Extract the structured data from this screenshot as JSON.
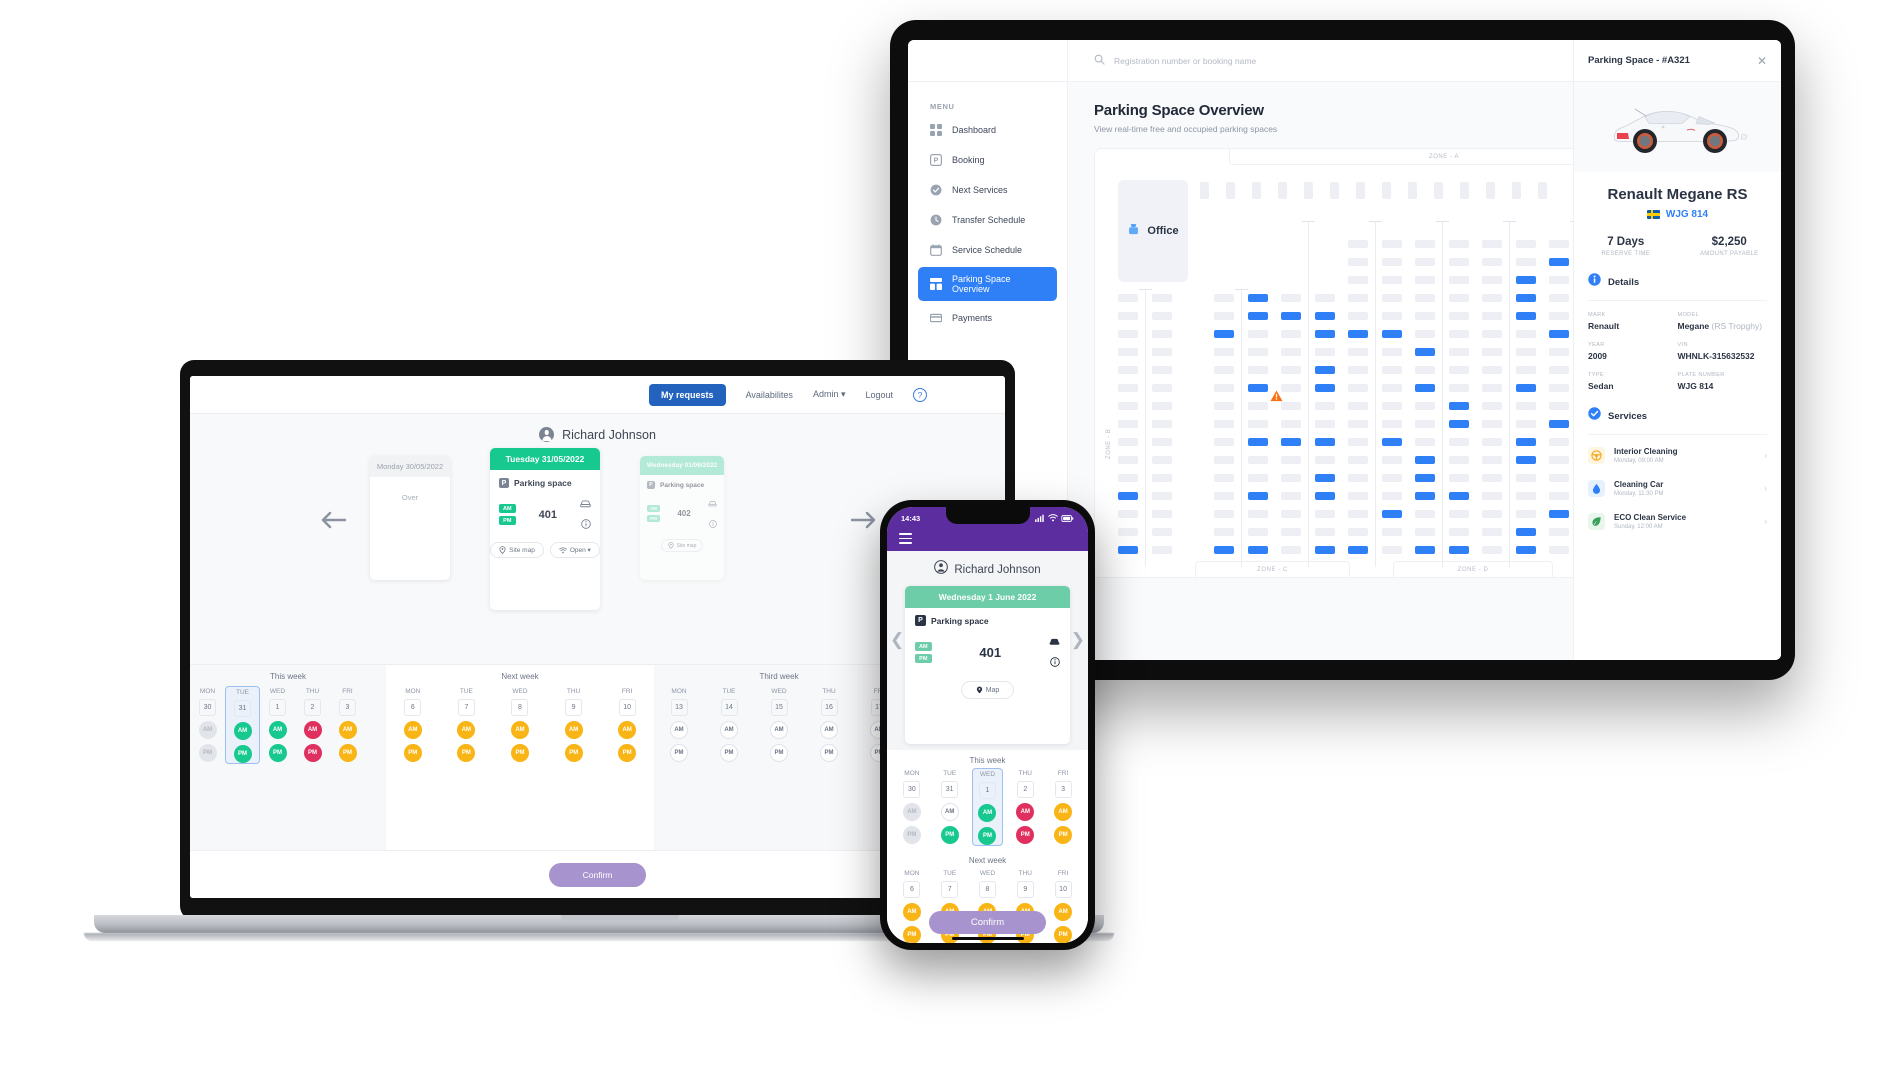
{
  "colors": {
    "accent_blue": "#2f80f7",
    "nav_active": "#2463bd",
    "green": "#17c98f",
    "green_light": "#7bdcbc",
    "red": "#e0305f",
    "amber": "#f9b515",
    "purple": "#a793cd",
    "phone_bar": "#5b2d9e"
  },
  "desktop": {
    "search": {
      "placeholder": "Registration number or booking name",
      "icon": "search-icon"
    },
    "sidebar": {
      "section_label": "MENU",
      "items": [
        {
          "label": "Dashboard",
          "icon": "grid-icon",
          "active": false
        },
        {
          "label": "Booking",
          "icon": "parking-p-icon",
          "active": false
        },
        {
          "label": "Next Services",
          "icon": "check-circle-icon",
          "active": false
        },
        {
          "label": "Transfer Schedule",
          "icon": "clock-icon",
          "active": false
        },
        {
          "label": "Service Schedule",
          "icon": "calendar-icon",
          "active": false
        },
        {
          "label": "Parking Space Overview",
          "icon": "layout-icon",
          "active": true
        },
        {
          "label": "Payments",
          "icon": "credit-card-icon",
          "active": false
        }
      ]
    },
    "page": {
      "title": "Parking Space Overview",
      "subtitle": "View real-time free and occupied parking spaces",
      "office_label": "Office",
      "zones": [
        "ZONE - A",
        "ZONE - B",
        "ZONE - C",
        "ZONE - D"
      ]
    },
    "detail": {
      "header_title": "Parking Space - #A321",
      "close_label": "✕",
      "car_name": "Renault Megane RS",
      "plate": "WJG 814",
      "stats": [
        {
          "value": "7 Days",
          "label": "RESERVE TIME"
        },
        {
          "value": "$2,250",
          "label": "AMOUNT PAYABLE"
        }
      ],
      "details_section": "Details",
      "fields": [
        {
          "key": "MARK",
          "value": "Renault",
          "note": ""
        },
        {
          "key": "MODEL",
          "value": "Megane",
          "note": "(RS Tropghy)"
        },
        {
          "key": "YEAR",
          "value": "2009",
          "note": ""
        },
        {
          "key": "VIN",
          "value": "WHNLK-315632532",
          "note": ""
        },
        {
          "key": "TYPE",
          "value": "Sedan",
          "note": ""
        },
        {
          "key": "PLATE NUMBER",
          "value": "WJG 814",
          "note": ""
        }
      ],
      "services_section": "Services",
      "services": [
        {
          "name": "Interior Cleaning",
          "when": "Monday, 09:00 AM",
          "icon": "steering-wheel-icon",
          "bg": "#fff6e0",
          "fg": "#f5ad2b"
        },
        {
          "name": "Cleaning Car",
          "when": "Monday, 11:30 PM",
          "icon": "water-drop-icon",
          "bg": "#e6f1fe",
          "fg": "#2f80f7"
        },
        {
          "name": "ECO Clean Service",
          "when": "Sunday, 12:00 AM",
          "icon": "leaf-icon",
          "bg": "#e8f6ec",
          "fg": "#39a05a"
        }
      ]
    }
  },
  "laptop": {
    "nav": [
      {
        "label": "My requests",
        "active": true
      },
      {
        "label": "Availabilites",
        "active": false
      },
      {
        "label": "Admin ▾",
        "active": false
      },
      {
        "label": "Logout",
        "active": false
      }
    ],
    "help_icon": "?",
    "user_name": "Richard Johnson",
    "cards": [
      {
        "date_label": "Monday 30/05/2022",
        "state": "over",
        "over_text": "Over"
      },
      {
        "date_label": "Tuesday 31/05/2022",
        "state": "active",
        "kind_label": "Parking space",
        "am": "AM",
        "pm": "PM",
        "number": "401",
        "buttons": [
          "Site map",
          "Open ▾"
        ]
      },
      {
        "date_label": "Wednesday 01/06/2022",
        "state": "next",
        "kind_label": "Parking space",
        "am": "AM",
        "pm": "PM",
        "number": "402",
        "buttons": [
          "Site map"
        ]
      }
    ],
    "weeks": [
      {
        "title": "This week",
        "days": [
          {
            "dow": "MON",
            "date": "30",
            "am": "gray",
            "pm": "gray",
            "selected": false
          },
          {
            "dow": "TUE",
            "date": "31",
            "am": "green",
            "pm": "green",
            "selected": true
          },
          {
            "dow": "WED",
            "date": "1",
            "am": "green",
            "pm": "green",
            "selected": false
          },
          {
            "dow": "THU",
            "date": "2",
            "am": "red",
            "pm": "red",
            "selected": false
          },
          {
            "dow": "FRI",
            "date": "3",
            "am": "amber",
            "pm": "amber",
            "selected": false
          }
        ]
      },
      {
        "title": "Next week",
        "days": [
          {
            "dow": "MON",
            "date": "6",
            "am": "amber",
            "pm": "amber",
            "selected": false
          },
          {
            "dow": "TUE",
            "date": "7",
            "am": "amber",
            "pm": "amber",
            "selected": false
          },
          {
            "dow": "WED",
            "date": "8",
            "am": "amber",
            "pm": "amber",
            "selected": false
          },
          {
            "dow": "THU",
            "date": "9",
            "am": "amber",
            "pm": "amber",
            "selected": false
          },
          {
            "dow": "FRI",
            "date": "10",
            "am": "amber",
            "pm": "amber",
            "selected": false
          }
        ]
      },
      {
        "title": "Third week",
        "days": [
          {
            "dow": "MON",
            "date": "13",
            "am": "out",
            "pm": "out",
            "selected": false
          },
          {
            "dow": "TUE",
            "date": "14",
            "am": "out",
            "pm": "out",
            "selected": false
          },
          {
            "dow": "WED",
            "date": "15",
            "am": "out",
            "pm": "out",
            "selected": false
          },
          {
            "dow": "THU",
            "date": "16",
            "am": "out",
            "pm": "out",
            "selected": false
          },
          {
            "dow": "FRI",
            "date": "17",
            "am": "out",
            "pm": "out",
            "selected": false
          }
        ]
      }
    ],
    "am_label": "AM",
    "pm_label": "PM",
    "confirm_label": "Confirm"
  },
  "phone": {
    "status_time": "14:43",
    "status_icons": "signal-wifi-battery",
    "menu_icon": "hamburger-icon",
    "user_name": "Richard Johnson",
    "card": {
      "date_label": "Wednesday 1 June 2022",
      "kind_label": "Parking space",
      "am": "AM",
      "pm": "PM",
      "number": "401",
      "map_button": "Map"
    },
    "weeks": [
      {
        "title": "This week",
        "days": [
          {
            "dow": "MON",
            "date": "30",
            "am": "gray",
            "pm": "gray",
            "selected": false
          },
          {
            "dow": "TUE",
            "date": "31",
            "am": "out",
            "pm": "green",
            "selected": false
          },
          {
            "dow": "WED",
            "date": "1",
            "am": "green",
            "pm": "green",
            "selected": true
          },
          {
            "dow": "THU",
            "date": "2",
            "am": "red",
            "pm": "red",
            "selected": false
          },
          {
            "dow": "FRI",
            "date": "3",
            "am": "amber",
            "pm": "amber",
            "selected": false
          }
        ]
      },
      {
        "title": "Next week",
        "days": [
          {
            "dow": "MON",
            "date": "6",
            "am": "amber",
            "pm": "amber",
            "selected": false
          },
          {
            "dow": "TUE",
            "date": "7",
            "am": "amber",
            "pm": "amber",
            "selected": false
          },
          {
            "dow": "WED",
            "date": "8",
            "am": "amber",
            "pm": "amber",
            "selected": false
          },
          {
            "dow": "THU",
            "date": "9",
            "am": "amber",
            "pm": "amber",
            "selected": false
          },
          {
            "dow": "FRI",
            "date": "10",
            "am": "amber",
            "pm": "amber",
            "selected": false
          }
        ]
      }
    ],
    "confirm_label": "Confirm"
  },
  "parking_map": {
    "note": "Grid of parking slots; blue = occupied, light gray = free",
    "columns": 14,
    "rows": 17,
    "occupied_color": "#2f80f7",
    "free_color": "#edeff4",
    "warning_icon": "warning-triangle-icon"
  }
}
